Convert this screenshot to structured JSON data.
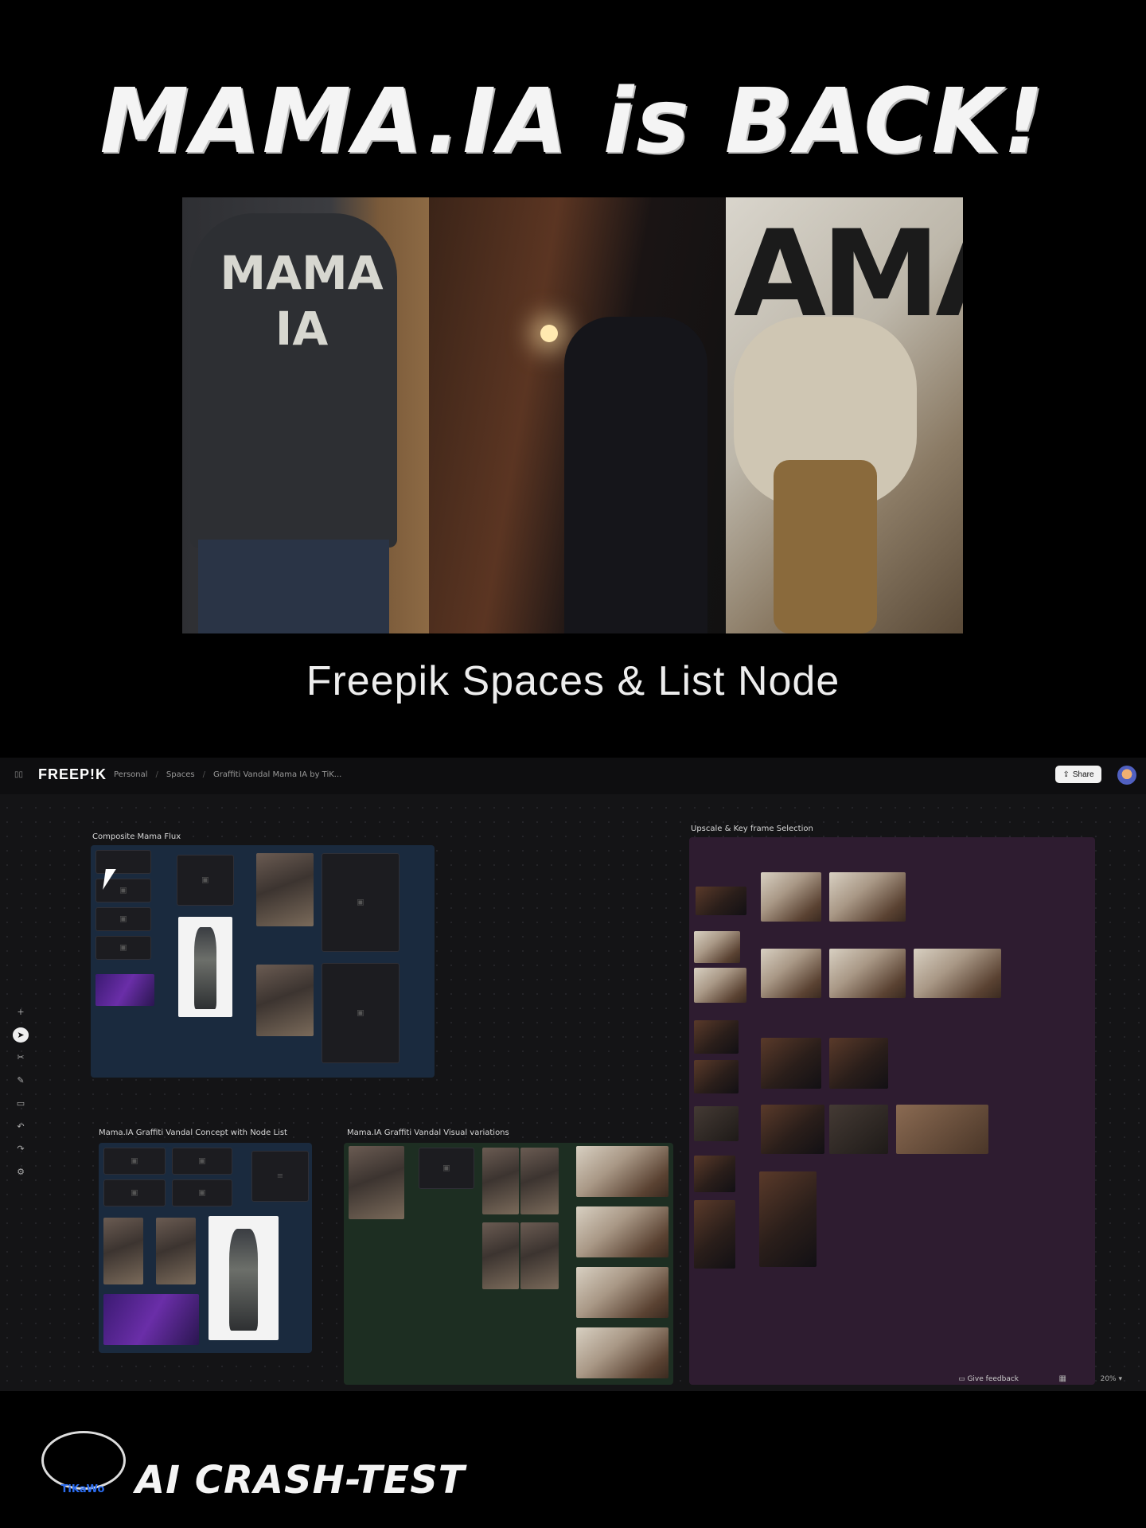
{
  "poster": {
    "title": "MAMA.IA is BACK!",
    "subtitle": "Freepik Spaces & List Node",
    "photo1_text": "MAMA IA",
    "photo3_text": "AMA"
  },
  "app": {
    "logo": "FREEP!K",
    "breadcrumbs": [
      "Personal",
      "Spaces",
      "Graffiti Vandal Mama IA by TiK..."
    ],
    "share_label": "Share",
    "groups": {
      "blue_top": "Composite Mama Flux",
      "blue_bottom": "Mama.IA Graffiti Vandal Concept with Node List",
      "green": "Mama.IA Graffiti Vandal Visual variations",
      "purple": "Upscale & Key frame Selection"
    },
    "feedback_label": "Give feedback",
    "zoom_label": "20%",
    "icons": [
      "panel-icon",
      "plus-icon",
      "pointer-icon",
      "scissors-icon",
      "pen-icon",
      "comment-icon",
      "undo-icon",
      "redo-icon",
      "settings-icon",
      "share-icon",
      "grid-icon",
      "chevron-down-icon"
    ]
  },
  "brand": {
    "name": "TiKaWo",
    "tagline": "AI CRASH-TEST"
  },
  "colors": {
    "background": "#000000",
    "canvas": "#141416",
    "group_blue": "#1a2a3e",
    "group_green": "#1d2e22",
    "group_purple": "#2e1c30",
    "brand_blue": "#2b6cf0"
  }
}
